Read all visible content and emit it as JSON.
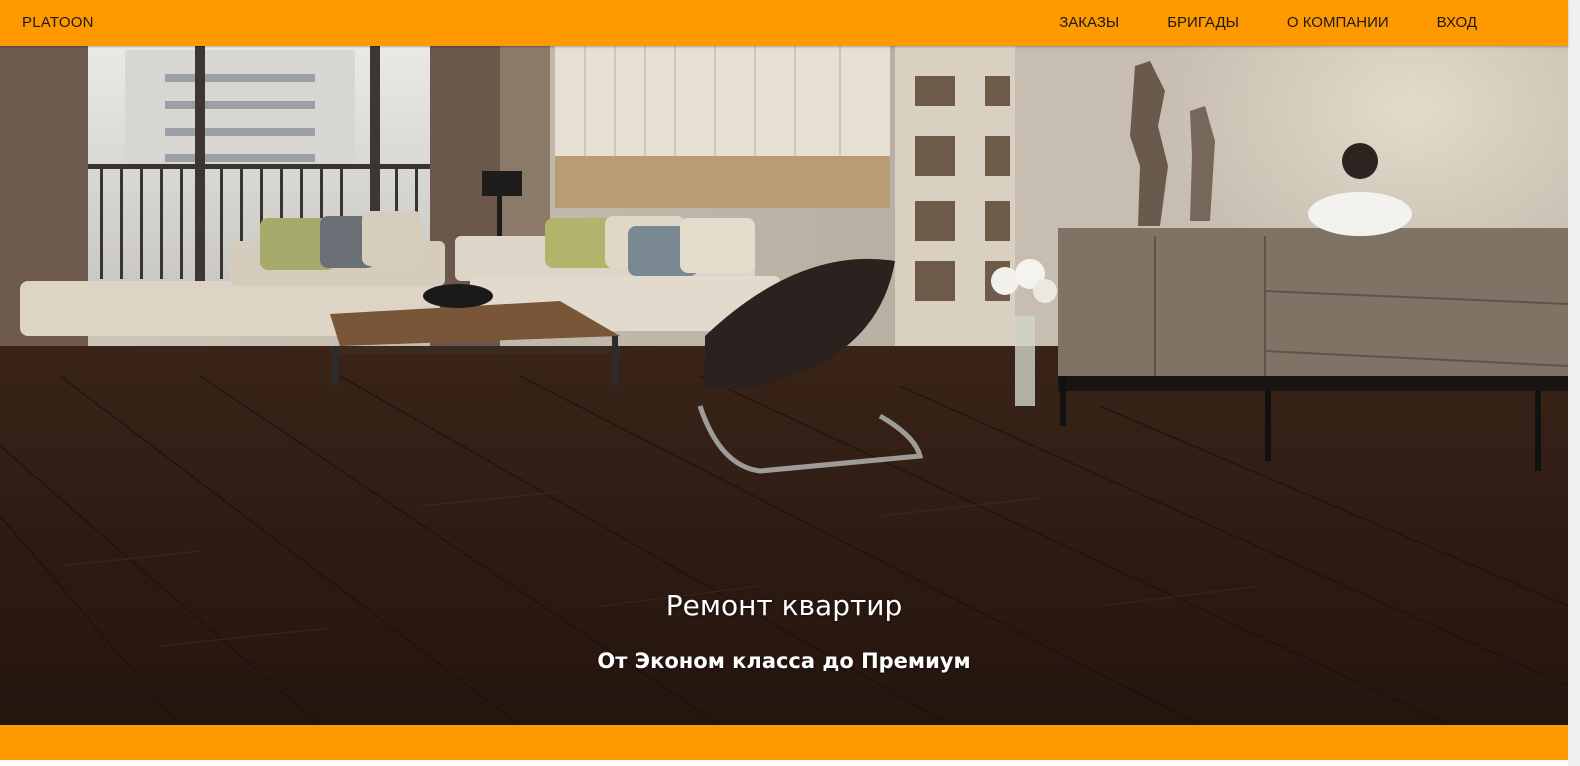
{
  "header": {
    "brand": "PLATOON",
    "nav": [
      "ЗАКАЗЫ",
      "БРИГАДЫ",
      "О КОМПАНИИ",
      "ВХОД"
    ]
  },
  "hero": {
    "title": "Ремонт квартир",
    "subtitle": "От Эконом класса до Премиум"
  },
  "colors": {
    "accent": "#ff9900",
    "hero_text": "#ffffff"
  }
}
